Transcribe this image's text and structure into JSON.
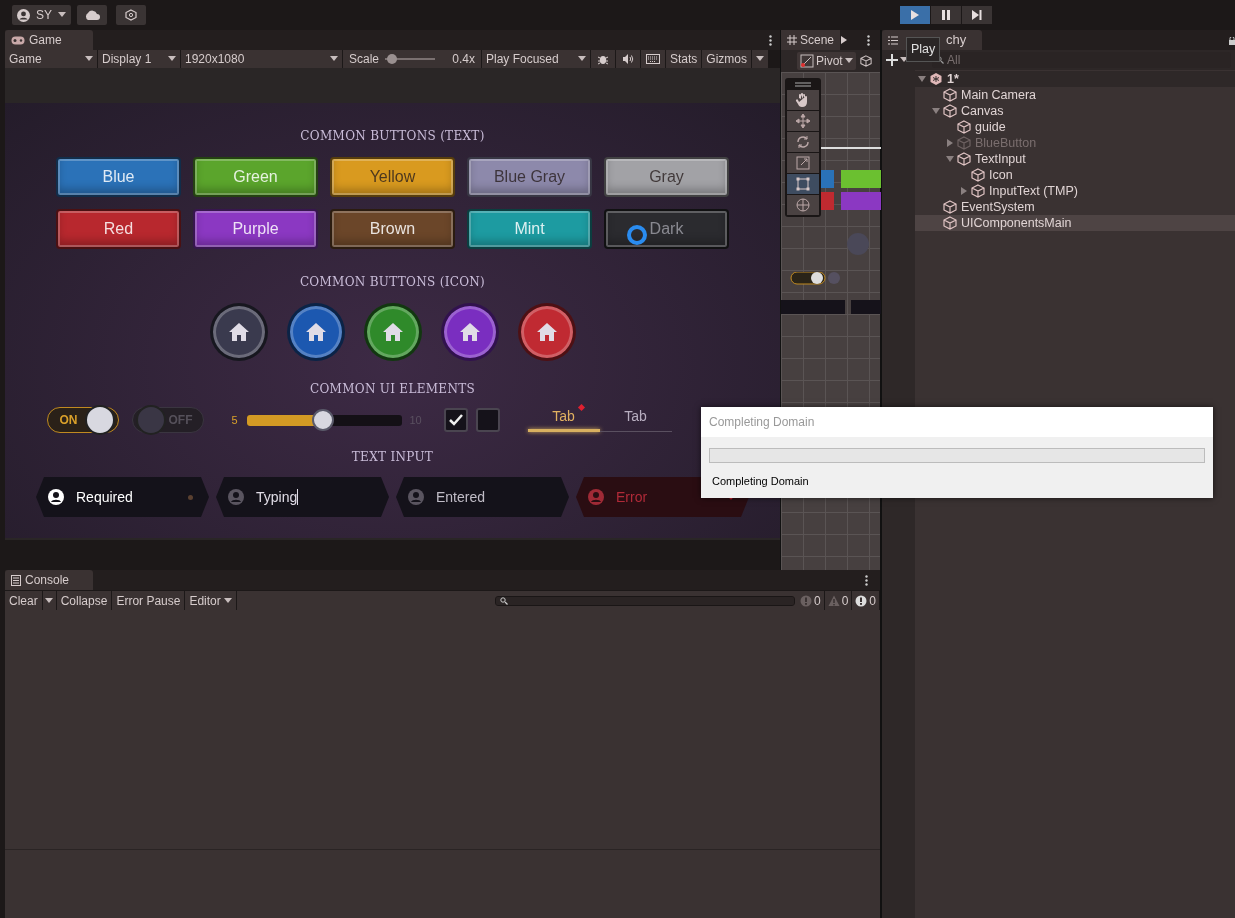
{
  "top_bar": {
    "account": "SY",
    "play_controls": [
      {
        "kind": "play",
        "selected": true
      },
      {
        "kind": "pause",
        "selected": false
      },
      {
        "kind": "step",
        "selected": false
      }
    ]
  },
  "tooltip": "Play",
  "game": {
    "tab": "Game",
    "toolbar": {
      "view": "Game",
      "display": "Display 1",
      "resolution": "1920x1080",
      "scale_label": "Scale",
      "scale": {
        "level": 0.05
      },
      "scale_reading": "0.4x",
      "play_mode": "Play Focused",
      "stats": "Stats",
      "gizmos": "Gizmos"
    },
    "text_buttons_title": "COMMON BUTTONS (TEXT)",
    "text_buttons": [
      {
        "label": "Blue",
        "color": "#2b72b8"
      },
      {
        "label": "Green",
        "color": "#5ba52c"
      },
      {
        "label": "Yellow",
        "color": "#d99a1f"
      },
      {
        "label": "Blue Gray",
        "color": "#8d89ab"
      },
      {
        "label": "Gray",
        "color": "#a2a2a6"
      },
      {
        "label": "Red",
        "color": "#b8282e"
      },
      {
        "label": "Purple",
        "color": "#8b38c2"
      },
      {
        "label": "Brown",
        "color": "#6b4629"
      },
      {
        "label": "Mint",
        "color": "#1d9ba1"
      },
      {
        "label": "Dark",
        "color": "#2b2b2f"
      }
    ],
    "icon_buttons_title": "COMMON BUTTONS (ICON)",
    "icon_buttons": [
      {
        "color": "#3a3a4e"
      },
      {
        "color": "#1c58b0"
      },
      {
        "color": "#2f8a2a"
      },
      {
        "color": "#7a2ec0"
      },
      {
        "color": "#c02a32"
      }
    ],
    "ui_elements_title": "COMMON UI ELEMENTS",
    "toggles": [
      {
        "label": "ON",
        "on": true
      },
      {
        "label": "OFF",
        "on": false
      }
    ],
    "slider": {
      "min_label": "5",
      "max_label": "10",
      "level": 0.49
    },
    "checkboxes": [
      {
        "checked": true
      },
      {
        "checked": false
      }
    ],
    "tabs": [
      {
        "label": "Tab",
        "selected": true,
        "badge": true
      },
      {
        "label": "Tab",
        "selected": false,
        "badge": false
      }
    ],
    "text_input_title": "TEXT INPUT",
    "text_inputs": [
      {
        "kind": "required",
        "value": "Required"
      },
      {
        "kind": "typing",
        "value": "Typing"
      },
      {
        "kind": "entered",
        "value": "Entered"
      },
      {
        "kind": "error",
        "value": "Error"
      }
    ]
  },
  "scene": {
    "tab": "Scene",
    "pivot": "Pivot",
    "tools": [
      {
        "kind": "hand",
        "selected": false
      },
      {
        "kind": "move",
        "selected": false
      },
      {
        "kind": "rotate",
        "selected": false
      },
      {
        "kind": "scale",
        "selected": false
      },
      {
        "kind": "rect",
        "selected": true
      },
      {
        "kind": "transform",
        "selected": false
      }
    ]
  },
  "hierarchy": {
    "tab": "chy",
    "search_placeholder": "All",
    "tree": [
      {
        "label": "1*",
        "kind": "scene",
        "expanded": true,
        "selected": false,
        "disabled": false,
        "children": [
          {
            "label": "Main Camera",
            "kind": "object",
            "selected": false,
            "disabled": false
          },
          {
            "label": "Canvas",
            "kind": "object",
            "expanded": true,
            "selected": false,
            "disabled": false,
            "children": [
              {
                "label": "guide",
                "kind": "object",
                "selected": false,
                "disabled": false
              },
              {
                "label": "BlueButton",
                "kind": "object",
                "expanded": false,
                "selected": false,
                "disabled": true
              },
              {
                "label": "TextInput",
                "kind": "object",
                "expanded": true,
                "selected": false,
                "disabled": false,
                "children": [
                  {
                    "label": "Icon",
                    "kind": "object",
                    "selected": false,
                    "disabled": false
                  },
                  {
                    "label": "InputText (TMP)",
                    "kind": "object",
                    "expanded": false,
                    "selected": false,
                    "disabled": false
                  }
                ]
              }
            ]
          },
          {
            "label": "EventSystem",
            "kind": "object",
            "selected": false,
            "disabled": false
          },
          {
            "label": "UIComponentsMain",
            "kind": "object",
            "selected": true,
            "disabled": false
          }
        ]
      }
    ]
  },
  "console": {
    "tab": "Console",
    "clear": "Clear",
    "collapse": "Collapse",
    "error_pause": "Error Pause",
    "editor": "Editor",
    "counts": [
      {
        "kind": "log",
        "count": "0"
      },
      {
        "kind": "warning",
        "count": "0"
      },
      {
        "kind": "error",
        "count": "0"
      }
    ]
  },
  "dialog": {
    "title": "Completing Domain",
    "level": 0,
    "message": "Completing Domain"
  }
}
